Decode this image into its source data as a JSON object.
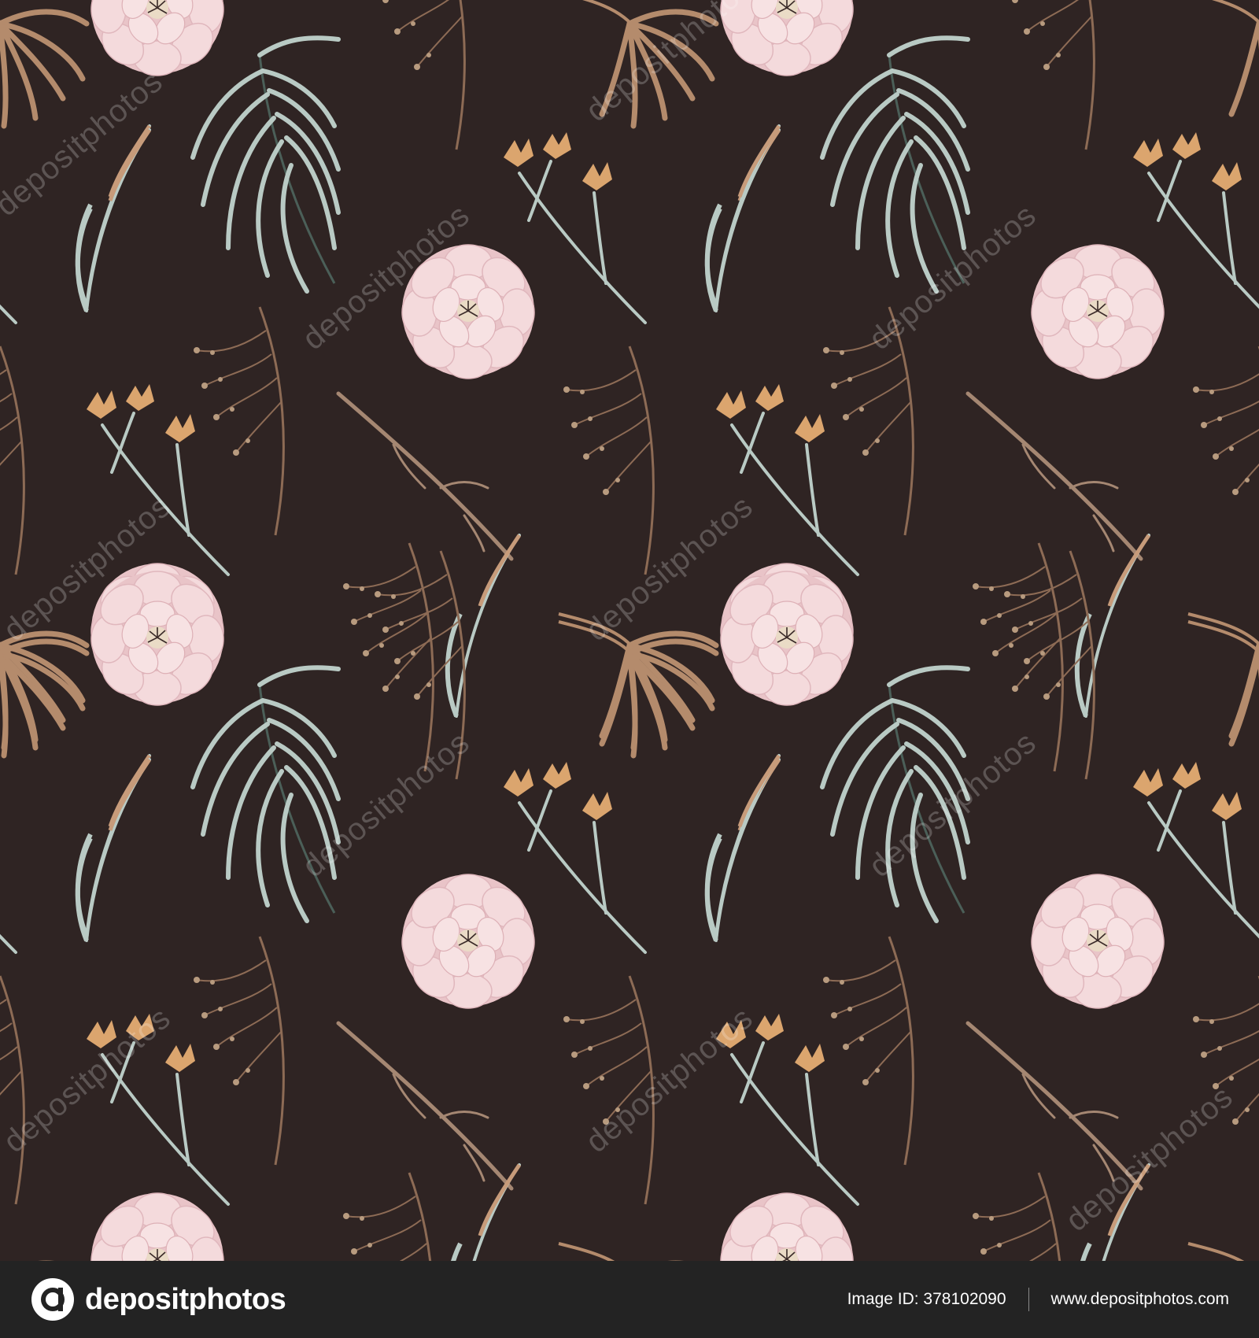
{
  "watermark": {
    "text": "depositphotos",
    "color": "#ffffff"
  },
  "footer": {
    "brand_name": "depositphotos",
    "image_id_label": "Image ID: 378102090",
    "website": "www.depositphotos.com",
    "background": "#232323"
  },
  "pattern": {
    "background": "#2f2423",
    "colors": {
      "peony": "#f2d3d6",
      "palm_leaf": "#b9cac4",
      "dried_palm": "#b48b6c",
      "dried_grass": "#8d6b55",
      "small_flower": "#dba56e"
    },
    "icons": [
      "pink-peony-icon",
      "sage-palm-leaf-icon",
      "dried-palm-icon",
      "dried-grass-icon",
      "small-bud-flower-icon",
      "twig-branch-icon"
    ]
  }
}
